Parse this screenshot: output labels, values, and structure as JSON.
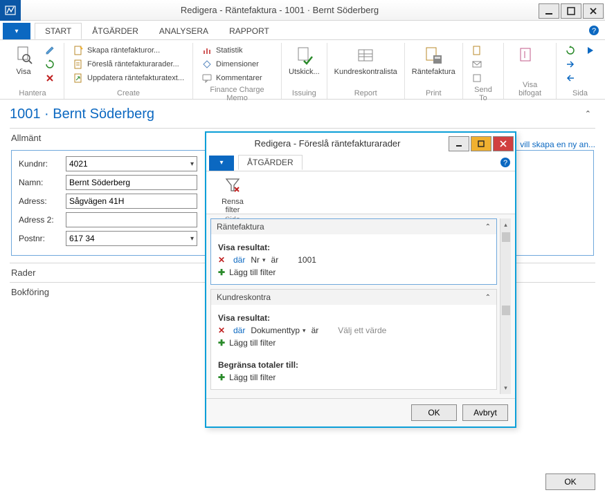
{
  "colors": {
    "accent": "#0b68c1",
    "danger": "#d04040",
    "warn": "#f0b030"
  },
  "window": {
    "title": "Redigera - Räntefaktura - 1001 · Bernt Söderberg"
  },
  "tabs": {
    "start": "START",
    "atgarder": "ÅTGÄRDER",
    "analysera": "ANALYSERA",
    "rapport": "RAPPORT"
  },
  "ribbon": {
    "hantera": {
      "title": "Hantera",
      "visa": "Visa"
    },
    "create": {
      "title": "Create",
      "skapa": "Skapa räntefakturor...",
      "foresla": "Föreslå räntefakturarader...",
      "uppdatera": "Uppdatera räntefakturatext..."
    },
    "fcmemo": {
      "title": "Finance Charge Memo",
      "statistik": "Statistik",
      "dimensioner": "Dimensioner",
      "kommentarer": "Kommentarer"
    },
    "issuing": {
      "title": "Issuing",
      "utskick": "Utskick..."
    },
    "report": {
      "title": "Report",
      "kundres": "Kundreskontralista"
    },
    "print": {
      "title": "Print",
      "rantefaktura": "Räntefaktura"
    },
    "sendto": {
      "title": "Send To"
    },
    "visabifogat": {
      "title": "Visa bifogat"
    },
    "sida": {
      "title": "Sida"
    }
  },
  "page": {
    "title": "1001 · Bernt Söderberg",
    "allmant": "Allmänt",
    "fields": {
      "kundnr_label": "Kundnr:",
      "kundnr_value": "4021",
      "namn_label": "Namn:",
      "namn_value": "Bernt Söderberg",
      "adress_label": "Adress:",
      "adress_value": "Sågvägen 41H",
      "adress2_label": "Adress 2:",
      "adress2_value": "",
      "postnr_label": "Postnr:",
      "postnr_value": "617 34"
    },
    "rader": "Rader",
    "bokforing": "Bokföring",
    "side_link": "vill skapa en ny an...",
    "ok": "OK"
  },
  "dialog": {
    "title": "Redigera - Föreslå räntefakturarader",
    "tab_atgarder": "ÅTGÄRDER",
    "rensa": "Rensa filter",
    "sida": "Sida",
    "sections": {
      "rantefaktura": "Räntefaktura",
      "kundreskontra": "Kundreskontra"
    },
    "labels": {
      "visa_resultat": "Visa resultat:",
      "begransa": "Begränsa totaler till:",
      "dar": "där",
      "ar": "är",
      "lagg_till": "Lägg till filter",
      "valj": "Välj ett värde"
    },
    "filter1": {
      "field": "Nr",
      "value": "1001"
    },
    "filter2": {
      "field": "Dokumenttyp"
    },
    "buttons": {
      "ok": "OK",
      "cancel": "Avbryt"
    }
  }
}
